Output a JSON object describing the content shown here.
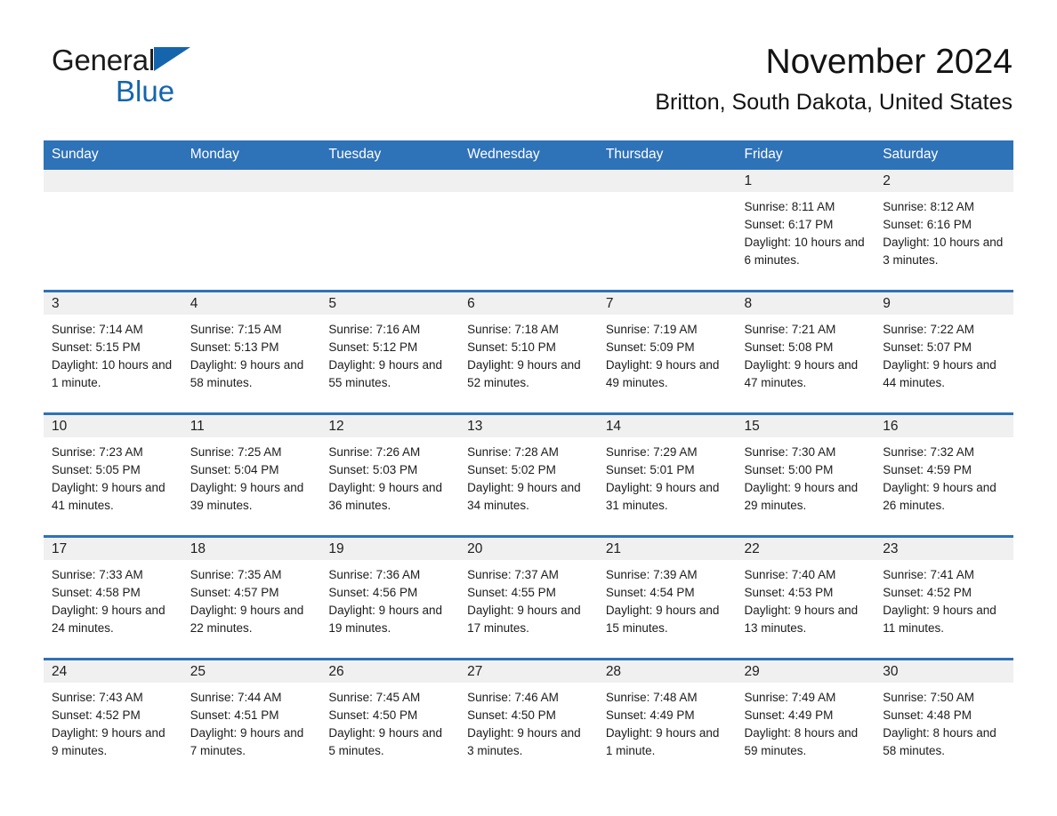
{
  "brand": {
    "word1": "General",
    "word2": "Blue",
    "triangle_color": "#1565ad",
    "icon": "triangle-logo-icon"
  },
  "header": {
    "month_title": "November 2024",
    "location": "Britton, South Dakota, United States"
  },
  "theme": {
    "header_blue": "#2e72b8",
    "daynum_band": "#f0f0f0",
    "text": "#1c1c1c"
  },
  "weekday_headers": [
    "Sunday",
    "Monday",
    "Tuesday",
    "Wednesday",
    "Thursday",
    "Friday",
    "Saturday"
  ],
  "labels": {
    "sunrise_prefix": "Sunrise:",
    "sunset_prefix": "Sunset:",
    "daylight_prefix": "Daylight:"
  },
  "weeks": [
    [
      {
        "day": "",
        "sunrise": "",
        "sunset": "",
        "daylight": ""
      },
      {
        "day": "",
        "sunrise": "",
        "sunset": "",
        "daylight": ""
      },
      {
        "day": "",
        "sunrise": "",
        "sunset": "",
        "daylight": ""
      },
      {
        "day": "",
        "sunrise": "",
        "sunset": "",
        "daylight": ""
      },
      {
        "day": "",
        "sunrise": "",
        "sunset": "",
        "daylight": ""
      },
      {
        "day": "1",
        "sunrise": "Sunrise: 8:11 AM",
        "sunset": "Sunset: 6:17 PM",
        "daylight": "Daylight: 10 hours and 6 minutes."
      },
      {
        "day": "2",
        "sunrise": "Sunrise: 8:12 AM",
        "sunset": "Sunset: 6:16 PM",
        "daylight": "Daylight: 10 hours and 3 minutes."
      }
    ],
    [
      {
        "day": "3",
        "sunrise": "Sunrise: 7:14 AM",
        "sunset": "Sunset: 5:15 PM",
        "daylight": "Daylight: 10 hours and 1 minute."
      },
      {
        "day": "4",
        "sunrise": "Sunrise: 7:15 AM",
        "sunset": "Sunset: 5:13 PM",
        "daylight": "Daylight: 9 hours and 58 minutes."
      },
      {
        "day": "5",
        "sunrise": "Sunrise: 7:16 AM",
        "sunset": "Sunset: 5:12 PM",
        "daylight": "Daylight: 9 hours and 55 minutes."
      },
      {
        "day": "6",
        "sunrise": "Sunrise: 7:18 AM",
        "sunset": "Sunset: 5:10 PM",
        "daylight": "Daylight: 9 hours and 52 minutes."
      },
      {
        "day": "7",
        "sunrise": "Sunrise: 7:19 AM",
        "sunset": "Sunset: 5:09 PM",
        "daylight": "Daylight: 9 hours and 49 minutes."
      },
      {
        "day": "8",
        "sunrise": "Sunrise: 7:21 AM",
        "sunset": "Sunset: 5:08 PM",
        "daylight": "Daylight: 9 hours and 47 minutes."
      },
      {
        "day": "9",
        "sunrise": "Sunrise: 7:22 AM",
        "sunset": "Sunset: 5:07 PM",
        "daylight": "Daylight: 9 hours and 44 minutes."
      }
    ],
    [
      {
        "day": "10",
        "sunrise": "Sunrise: 7:23 AM",
        "sunset": "Sunset: 5:05 PM",
        "daylight": "Daylight: 9 hours and 41 minutes."
      },
      {
        "day": "11",
        "sunrise": "Sunrise: 7:25 AM",
        "sunset": "Sunset: 5:04 PM",
        "daylight": "Daylight: 9 hours and 39 minutes."
      },
      {
        "day": "12",
        "sunrise": "Sunrise: 7:26 AM",
        "sunset": "Sunset: 5:03 PM",
        "daylight": "Daylight: 9 hours and 36 minutes."
      },
      {
        "day": "13",
        "sunrise": "Sunrise: 7:28 AM",
        "sunset": "Sunset: 5:02 PM",
        "daylight": "Daylight: 9 hours and 34 minutes."
      },
      {
        "day": "14",
        "sunrise": "Sunrise: 7:29 AM",
        "sunset": "Sunset: 5:01 PM",
        "daylight": "Daylight: 9 hours and 31 minutes."
      },
      {
        "day": "15",
        "sunrise": "Sunrise: 7:30 AM",
        "sunset": "Sunset: 5:00 PM",
        "daylight": "Daylight: 9 hours and 29 minutes."
      },
      {
        "day": "16",
        "sunrise": "Sunrise: 7:32 AM",
        "sunset": "Sunset: 4:59 PM",
        "daylight": "Daylight: 9 hours and 26 minutes."
      }
    ],
    [
      {
        "day": "17",
        "sunrise": "Sunrise: 7:33 AM",
        "sunset": "Sunset: 4:58 PM",
        "daylight": "Daylight: 9 hours and 24 minutes."
      },
      {
        "day": "18",
        "sunrise": "Sunrise: 7:35 AM",
        "sunset": "Sunset: 4:57 PM",
        "daylight": "Daylight: 9 hours and 22 minutes."
      },
      {
        "day": "19",
        "sunrise": "Sunrise: 7:36 AM",
        "sunset": "Sunset: 4:56 PM",
        "daylight": "Daylight: 9 hours and 19 minutes."
      },
      {
        "day": "20",
        "sunrise": "Sunrise: 7:37 AM",
        "sunset": "Sunset: 4:55 PM",
        "daylight": "Daylight: 9 hours and 17 minutes."
      },
      {
        "day": "21",
        "sunrise": "Sunrise: 7:39 AM",
        "sunset": "Sunset: 4:54 PM",
        "daylight": "Daylight: 9 hours and 15 minutes."
      },
      {
        "day": "22",
        "sunrise": "Sunrise: 7:40 AM",
        "sunset": "Sunset: 4:53 PM",
        "daylight": "Daylight: 9 hours and 13 minutes."
      },
      {
        "day": "23",
        "sunrise": "Sunrise: 7:41 AM",
        "sunset": "Sunset: 4:52 PM",
        "daylight": "Daylight: 9 hours and 11 minutes."
      }
    ],
    [
      {
        "day": "24",
        "sunrise": "Sunrise: 7:43 AM",
        "sunset": "Sunset: 4:52 PM",
        "daylight": "Daylight: 9 hours and 9 minutes."
      },
      {
        "day": "25",
        "sunrise": "Sunrise: 7:44 AM",
        "sunset": "Sunset: 4:51 PM",
        "daylight": "Daylight: 9 hours and 7 minutes."
      },
      {
        "day": "26",
        "sunrise": "Sunrise: 7:45 AM",
        "sunset": "Sunset: 4:50 PM",
        "daylight": "Daylight: 9 hours and 5 minutes."
      },
      {
        "day": "27",
        "sunrise": "Sunrise: 7:46 AM",
        "sunset": "Sunset: 4:50 PM",
        "daylight": "Daylight: 9 hours and 3 minutes."
      },
      {
        "day": "28",
        "sunrise": "Sunrise: 7:48 AM",
        "sunset": "Sunset: 4:49 PM",
        "daylight": "Daylight: 9 hours and 1 minute."
      },
      {
        "day": "29",
        "sunrise": "Sunrise: 7:49 AM",
        "sunset": "Sunset: 4:49 PM",
        "daylight": "Daylight: 8 hours and 59 minutes."
      },
      {
        "day": "30",
        "sunrise": "Sunrise: 7:50 AM",
        "sunset": "Sunset: 4:48 PM",
        "daylight": "Daylight: 8 hours and 58 minutes."
      }
    ]
  ]
}
